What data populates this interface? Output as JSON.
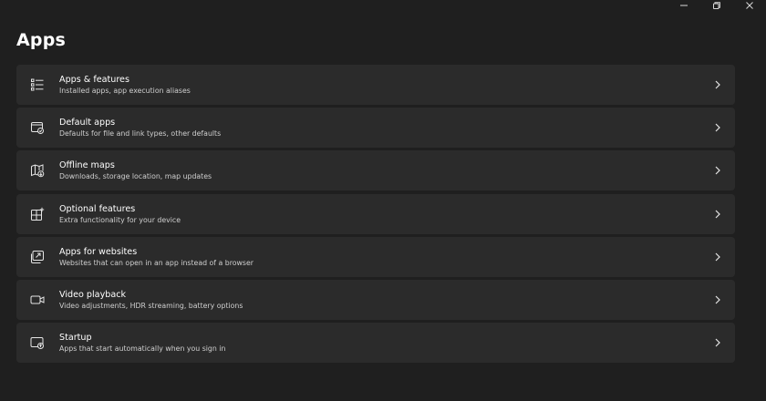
{
  "window": {
    "minimize_icon": "minimize-icon",
    "maximize_icon": "restore-icon",
    "close_icon": "close-icon"
  },
  "page": {
    "title": "Apps"
  },
  "items": [
    {
      "label": "Apps & features",
      "description": "Installed apps, app execution aliases",
      "icon": "list-icon"
    },
    {
      "label": "Default apps",
      "description": "Defaults for file and link types, other defaults",
      "icon": "default-apps-icon"
    },
    {
      "label": "Offline maps",
      "description": "Downloads, storage location, map updates",
      "icon": "map-download-icon"
    },
    {
      "label": "Optional features",
      "description": "Extra functionality for your device",
      "icon": "grid-add-icon"
    },
    {
      "label": "Apps for websites",
      "description": "Websites that can open in an app instead of a browser",
      "icon": "open-in-app-icon"
    },
    {
      "label": "Video playback",
      "description": "Video adjustments, HDR streaming, battery options",
      "icon": "video-icon"
    },
    {
      "label": "Startup",
      "description": "Apps that start automatically when you sign in",
      "icon": "startup-icon"
    }
  ],
  "colors": {
    "background": "#1f1f1f",
    "card": "#2b2b2b",
    "text_primary": "#ffffff",
    "text_secondary": "#cfcfcf"
  }
}
